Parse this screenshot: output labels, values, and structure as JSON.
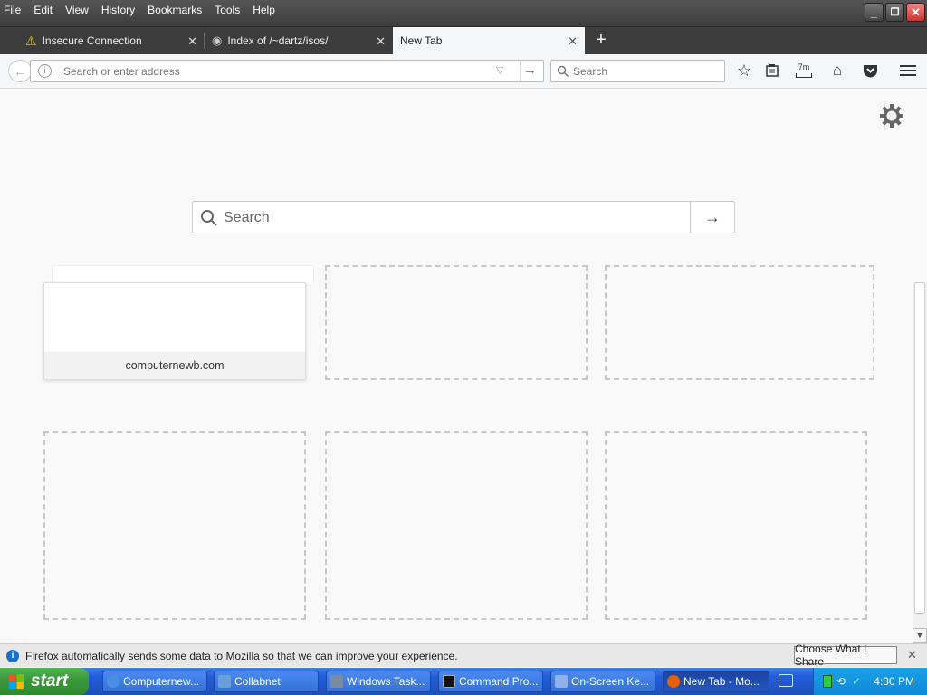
{
  "menu": {
    "items": [
      "File",
      "Edit",
      "View",
      "History",
      "Bookmarks",
      "Tools",
      "Help"
    ]
  },
  "tabs": [
    {
      "label": "Insecure Connection",
      "icon": "warning-icon"
    },
    {
      "label": "Index of /~dartz/isos/",
      "icon": "globe-icon"
    },
    {
      "label": "New Tab",
      "icon": ""
    }
  ],
  "urlbar": {
    "placeholder": "Search or enter address"
  },
  "searchbar": {
    "placeholder": "Search"
  },
  "toolbar": {
    "badge": "7m"
  },
  "newtab": {
    "search_placeholder": "Search",
    "tiles": [
      {
        "label": "computernewb.com"
      }
    ]
  },
  "notification": {
    "text": "Firefox automatically sends some data to Mozilla so that we can improve your experience.",
    "button": "Choose What I Share"
  },
  "taskbar": {
    "start": "start",
    "tasks": [
      {
        "label": "Computernew...",
        "icon": "chrome-icon",
        "color": "#4a90e2"
      },
      {
        "label": "Collabnet",
        "icon": "network-icon",
        "color": "#6aa0d8"
      },
      {
        "label": "Windows Task...",
        "icon": "task-manager-icon",
        "color": "#7a8aa0"
      },
      {
        "label": "Command Pro...",
        "icon": "cmd-icon",
        "color": "#111111"
      },
      {
        "label": "On-Screen Ke...",
        "icon": "keyboard-icon",
        "color": "#8fb0e8"
      },
      {
        "label": "New Tab - Mo...",
        "icon": "firefox-icon",
        "color": "#e66000"
      }
    ],
    "clock": "4:30 PM"
  }
}
